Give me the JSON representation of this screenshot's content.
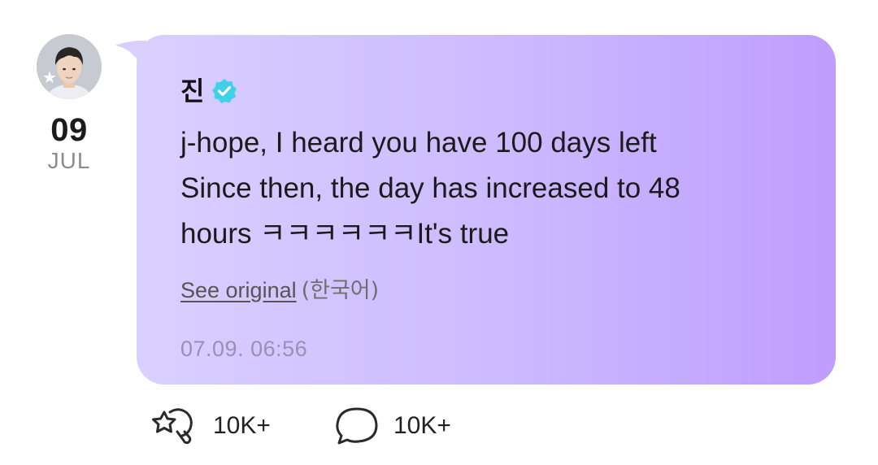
{
  "post": {
    "author": "진",
    "date_day": "09",
    "date_month": "JUL",
    "message_lines": [
      "j-hope, I heard you have 100 days left",
      "Since then, the day has increased to 48",
      "hours ㅋㅋㅋㅋㅋㅋIt's true"
    ],
    "see_original_label": "See original",
    "original_language": "(한국어)",
    "timestamp": "07.09. 06:56"
  },
  "actions": {
    "like_count": "10K+",
    "comment_count": "10K+"
  },
  "icons": {
    "verified": "verified-badge-icon",
    "like": "reaction-like-icon",
    "comment": "comment-bubble-icon",
    "avatar_badge": "star-icon"
  },
  "colors": {
    "bubble_start": "#d9d0ff",
    "bubble_end": "#bf9dfe",
    "verified": "#3fd0ea",
    "timestamp": "#9a90b6"
  }
}
